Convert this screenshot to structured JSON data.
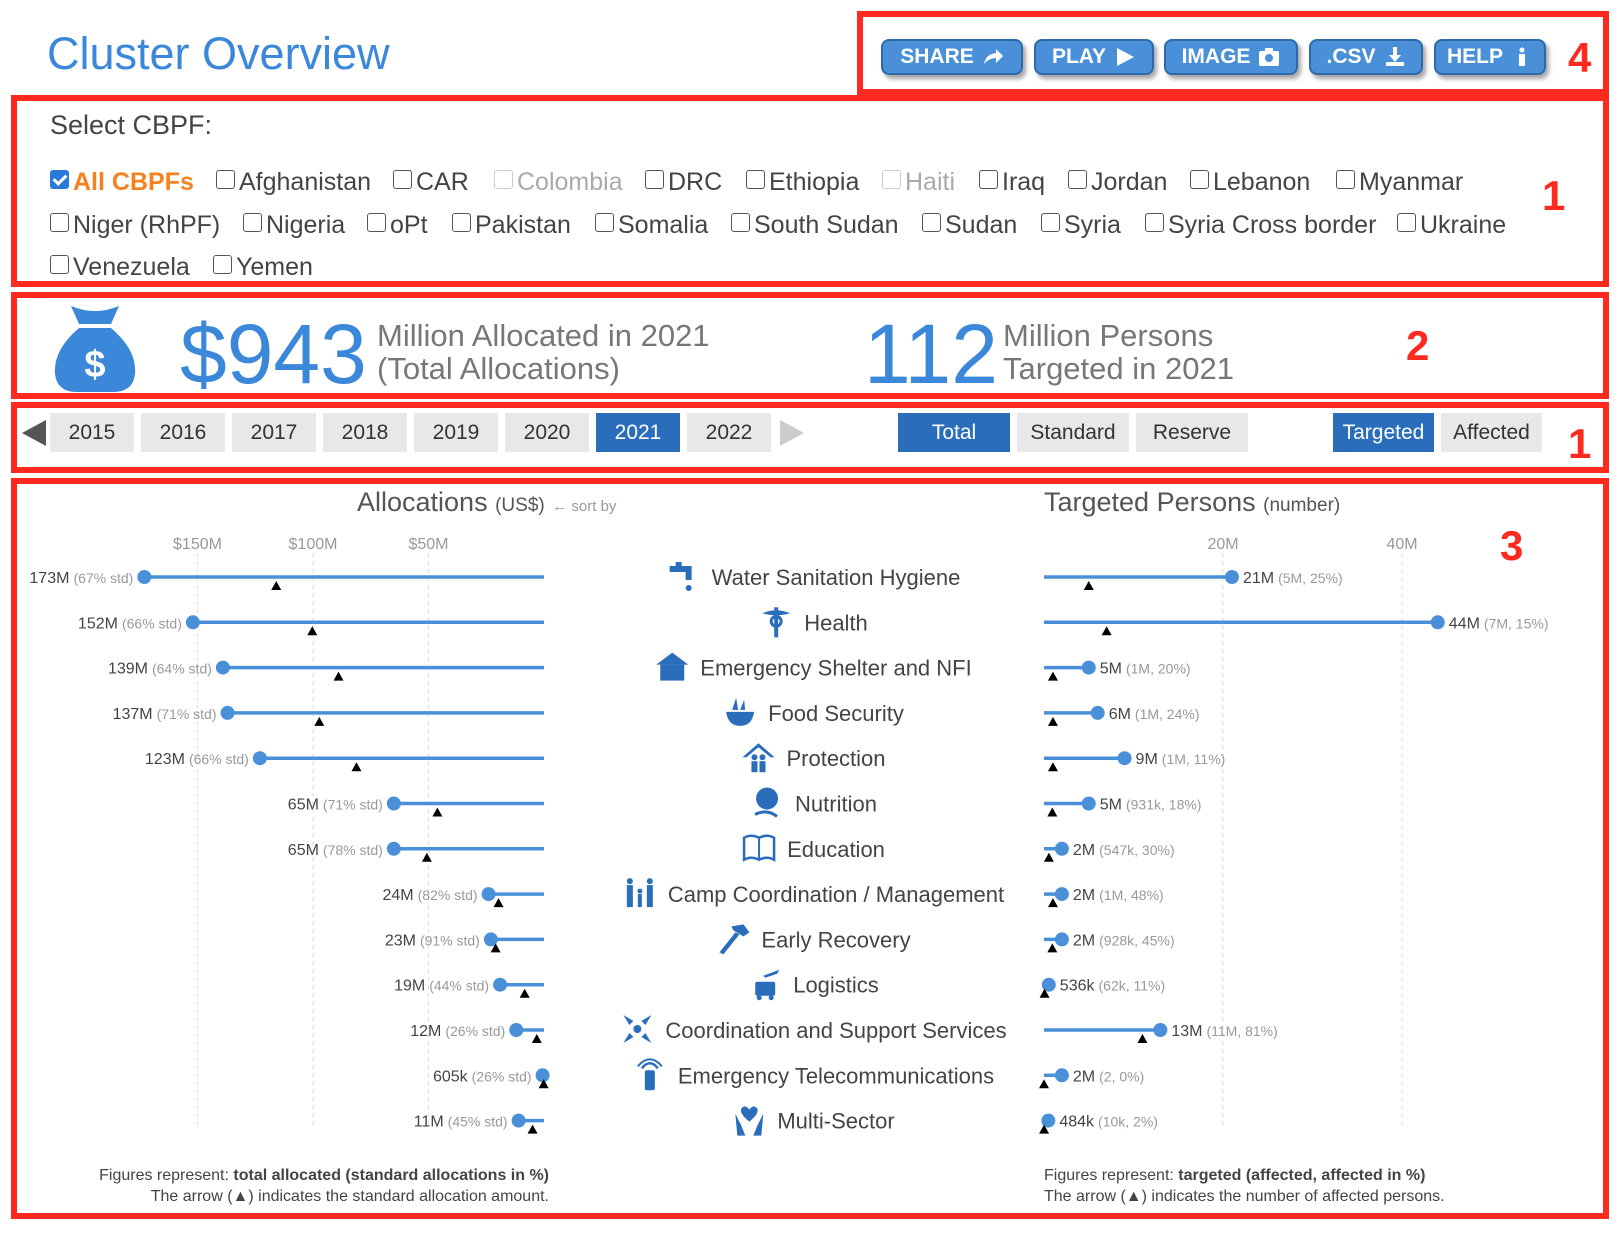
{
  "header": {
    "title": "Cluster Overview"
  },
  "toolbar": [
    {
      "label": "SHARE",
      "icon": "share-arrow-icon"
    },
    {
      "label": "PLAY",
      "icon": "play-icon"
    },
    {
      "label": "IMAGE",
      "icon": "camera-icon"
    },
    {
      "label": ".CSV",
      "icon": "download-icon"
    },
    {
      "label": "HELP",
      "icon": "info-icon"
    }
  ],
  "annotations": {
    "box1": "1",
    "box2": "2",
    "box1b": "1",
    "box3": "3",
    "box4": "4"
  },
  "selector": {
    "label": "Select CBPF:",
    "options": [
      {
        "label": "All CBPFs",
        "checked": true
      },
      {
        "label": "Afghanistan"
      },
      {
        "label": "CAR"
      },
      {
        "label": "Colombia",
        "disabled": true
      },
      {
        "label": "DRC"
      },
      {
        "label": "Ethiopia"
      },
      {
        "label": "Haiti",
        "disabled": true
      },
      {
        "label": "Iraq"
      },
      {
        "label": "Jordan"
      },
      {
        "label": "Lebanon"
      },
      {
        "label": "Myanmar"
      },
      {
        "label": "Niger (RhPF)"
      },
      {
        "label": "Nigeria"
      },
      {
        "label": "oPt"
      },
      {
        "label": "Pakistan"
      },
      {
        "label": "Somalia"
      },
      {
        "label": "South Sudan"
      },
      {
        "label": "Sudan"
      },
      {
        "label": "Syria"
      },
      {
        "label": "Syria Cross border"
      },
      {
        "label": "Ukraine"
      },
      {
        "label": "Venezuela"
      },
      {
        "label": "Yemen"
      }
    ]
  },
  "summary": {
    "allocated_value": "$943",
    "allocated_line1": "Million Allocated in 2021",
    "allocated_line2": "(Total Allocations)",
    "persons_value": "112",
    "persons_line1": "Million Persons",
    "persons_line2": "Targeted in 2021",
    "icon": "money-bag-icon"
  },
  "years": {
    "options": [
      "2015",
      "2016",
      "2017",
      "2018",
      "2019",
      "2020",
      "2021",
      "2022"
    ],
    "selected": "2021"
  },
  "allocation_type": {
    "options": [
      "Total",
      "Standard",
      "Reserve"
    ],
    "selected": "Total"
  },
  "persons_type": {
    "options": [
      "Targeted",
      "Affected"
    ],
    "selected": "Targeted"
  },
  "colors": {
    "accent": "#3b87d9",
    "selected": "#2a6ebb",
    "line": "#4a90d9",
    "annotation": "#ff2a1f",
    "highlight": "#f5811f"
  },
  "chart_data": [
    {
      "type": "lollipop",
      "title": "Allocations",
      "unit": "(US$)",
      "sort_hint": "← sort by",
      "axis_direction": "reversed",
      "ticks": [
        "$150M",
        "$100M",
        "$50M"
      ],
      "tick_values": [
        150,
        100,
        50
      ],
      "grid": true,
      "values_musd": [
        173,
        152,
        139,
        137,
        123,
        65,
        65,
        24,
        23,
        19,
        12,
        0.605,
        11
      ],
      "labels": [
        "173M",
        "152M",
        "139M",
        "137M",
        "123M",
        "65M",
        "65M",
        "24M",
        "23M",
        "19M",
        "12M",
        "605k",
        "11M"
      ],
      "std_pct": [
        "(67% std)",
        "(66% std)",
        "(64% std)",
        "(71% std)",
        "(66% std)",
        "(71% std)",
        "(78% std)",
        "(82% std)",
        "(91% std)",
        "(44% std)",
        "(26% std)",
        "(26% std)",
        "(45% std)"
      ],
      "std_fraction": [
        0.67,
        0.66,
        0.64,
        0.71,
        0.66,
        0.71,
        0.78,
        0.82,
        0.91,
        0.44,
        0.26,
        0.26,
        0.45
      ],
      "footnote_1_prefix": "Figures represent: ",
      "footnote_1_bold": "total allocated (standard allocations in %)",
      "footnote_2": "The arrow (▲) indicates the standard allocation amount."
    },
    {
      "type": "lollipop",
      "title": "Targeted Persons",
      "unit": "(number)",
      "ticks": [
        "20M",
        "40M"
      ],
      "tick_values": [
        20,
        40
      ],
      "grid": true,
      "values_m": [
        21,
        44,
        5,
        6,
        9,
        5,
        2,
        2,
        2,
        0.536,
        13,
        2,
        0.484
      ],
      "labels": [
        "21M",
        "44M",
        "5M",
        "6M",
        "9M",
        "5M",
        "2M",
        "2M",
        "2M",
        "536k",
        "13M",
        "2M",
        "484k"
      ],
      "affected_labels": [
        "(5M, 25%)",
        "(7M, 15%)",
        "(1M, 20%)",
        "(1M, 24%)",
        "(1M, 11%)",
        "(931k, 18%)",
        "(547k, 30%)",
        "(1M, 48%)",
        "(928k, 45%)",
        "(62k, 11%)",
        "(11M, 81%)",
        "(2, 0%)",
        "(10k, 2%)"
      ],
      "affected_m": [
        5,
        7,
        1,
        1,
        1,
        0.931,
        0.547,
        1,
        0.928,
        0.062,
        11,
        2e-06,
        0.01
      ],
      "footnote_1_prefix": "Figures represent: ",
      "footnote_1_bold": "targeted (affected, affected in %)",
      "footnote_2": "The arrow (▲) indicates the number of affected persons."
    }
  ],
  "clusters": [
    {
      "name": "Water Sanitation Hygiene",
      "icon": "water-tap-icon"
    },
    {
      "name": "Health",
      "icon": "caduceus-icon"
    },
    {
      "name": "Emergency Shelter and NFI",
      "icon": "shelter-icon"
    },
    {
      "name": "Food Security",
      "icon": "food-bowl-icon"
    },
    {
      "name": "Protection",
      "icon": "protection-house-icon"
    },
    {
      "name": "Nutrition",
      "icon": "nutrition-icon"
    },
    {
      "name": "Education",
      "icon": "book-icon"
    },
    {
      "name": "Camp Coordination / Management",
      "icon": "family-icon"
    },
    {
      "name": "Early Recovery",
      "icon": "hammer-icon"
    },
    {
      "name": "Logistics",
      "icon": "truck-plane-icon"
    },
    {
      "name": "Coordination and Support Services",
      "icon": "coordination-arrows-icon"
    },
    {
      "name": "Emergency Telecommunications",
      "icon": "radio-icon"
    },
    {
      "name": "Multi-Sector",
      "icon": "hands-heart-icon"
    }
  ]
}
